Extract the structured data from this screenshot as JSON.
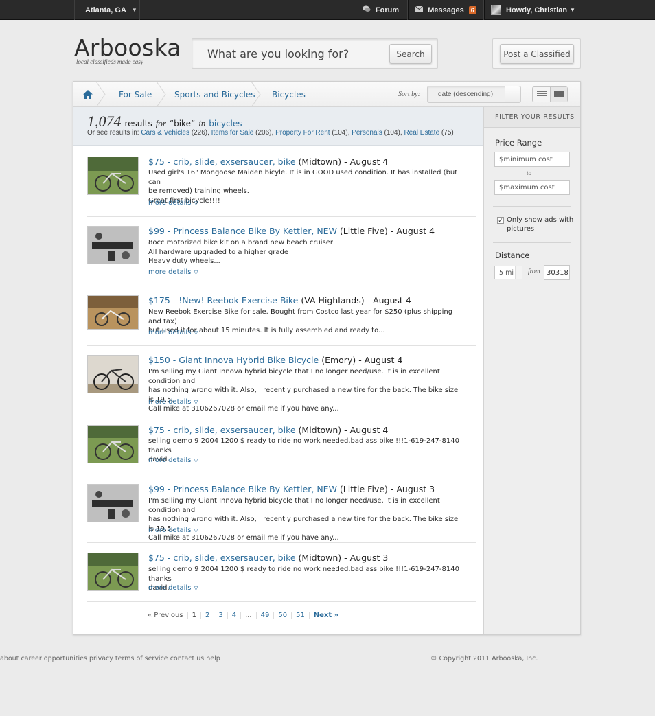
{
  "topbar": {
    "location": "Atlanta, GA",
    "forum": "Forum",
    "messages": "Messages",
    "messages_count": "6",
    "user_greeting": "Howdy, Christian"
  },
  "header": {
    "logo": "Arbooska",
    "tagline": "local classifieds made easy",
    "search_placeholder": "What are you looking for?",
    "search_button": "Search",
    "post_button": "Post a Classified"
  },
  "breadcrumb": {
    "items": [
      "For Sale",
      "Sports and Bicycles",
      "Bicycles"
    ]
  },
  "sort": {
    "label": "Sort by:",
    "value": "date (descending)"
  },
  "results": {
    "count": "1,074",
    "results_word": "results",
    "for_word": "for",
    "query": "“bike”",
    "in_word": "in",
    "category": "bicycles",
    "see_also_prefix": "Or see results in:",
    "see_also": [
      {
        "name": "Cars & Vehicles",
        "count": "(226)"
      },
      {
        "name": "Items for Sale",
        "count": "(206)"
      },
      {
        "name": "Property For Rent",
        "count": "(104)"
      },
      {
        "name": "Personals",
        "count": "(104)"
      },
      {
        "name": "Real Estate",
        "count": "(75)"
      }
    ]
  },
  "listings": [
    {
      "price_title": "$75 - crib, slide, exsersaucer, bike",
      "location": "(Midtown)",
      "date": "- August 4",
      "desc": [
        "Used girl's 16\" Mongoose Maiden bicyle. It is in GOOD used condition. It has installed (but can",
        "be removed) training wheels.",
        "Great first bicycle!!!!"
      ],
      "more": "more details"
    },
    {
      "price_title": "$99 - Princess Balance Bike By Kettler, NEW",
      "location": "(Little Five)",
      "date": "- August 4",
      "desc": [
        "8occ motorized bike kit on a brand new beach cruiser",
        "All hardware upgraded to a higher grade",
        "Heavy duty wheels..."
      ],
      "more": "more details"
    },
    {
      "price_title": "$175 - !New! Reebok Exercise Bike",
      "location": "(VA Highlands)",
      "date": "- August 4",
      "desc": [
        "New Reebok Exercise Bike for sale. Bought from Costco last year for $250 (plus shipping and tax)",
        "but used it for about 15 minutes. It is fully assembled and ready to..."
      ],
      "more": "more details"
    },
    {
      "price_title": "$150 - Giant Innova Hybrid Bike Bicycle",
      "location": "(Emory)",
      "date": "- August 4",
      "desc": [
        "I'm selling my Giant Innova hybrid bicycle that I no longer need/use. It is in excellent condition and",
        "has nothing wrong with it. Also, I recently purchased a new tire for the back. The bike size is 19.5.",
        "Call mike at 3106267028 or email me if you have any..."
      ],
      "more": "more details"
    },
    {
      "price_title": "$75 - crib, slide, exsersaucer, bike",
      "location": "(Midtown)",
      "date": "- August 4",
      "desc": [
        "selling demo 9 2004 1200 $ ready to ride no work needed.bad ass bike !!!1-619-247-8140 thanks",
        "david."
      ],
      "more": "more details"
    },
    {
      "price_title": "$99 - Princess Balance Bike By Kettler, NEW",
      "location": "(Little Five)",
      "date": "- August 3",
      "desc": [
        "I'm selling my Giant Innova hybrid bicycle that I no longer need/use. It is in excellent condition and",
        "has nothing wrong with it. Also, I recently purchased a new tire for the back. The bike size is 19.5.",
        "Call mike at 3106267028 or email me if you have any..."
      ],
      "more": "more details"
    },
    {
      "price_title": "$75 - crib, slide, exsersaucer, bike",
      "location": "(Midtown)",
      "date": "- August 3",
      "desc": [
        "selling demo 9 2004 1200 $ ready to ride no work needed.bad ass bike !!!1-619-247-8140 thanks",
        "david."
      ],
      "more": "more details"
    }
  ],
  "pager": {
    "prev": "« Previous",
    "pages": [
      "1",
      "2",
      "3",
      "4",
      "...",
      "49",
      "50",
      "51"
    ],
    "next": "Next »"
  },
  "filters": {
    "heading": "FILTER YOUR RESULTS",
    "price_label": "Price Range",
    "min_placeholder": "$minimum cost",
    "to": "to",
    "max_placeholder": "$maximum cost",
    "pictures_only": "Only show ads with pictures",
    "pictures_checked": true,
    "distance_label": "Distance",
    "distance_value": "5 mi",
    "from": "from",
    "zip": "30318"
  },
  "footer": {
    "links": [
      "about",
      "career opportunities",
      "privacy",
      "terms of service",
      "contact us",
      "help"
    ],
    "copyright": "© Copyright 2011 Arbooska, Inc."
  }
}
